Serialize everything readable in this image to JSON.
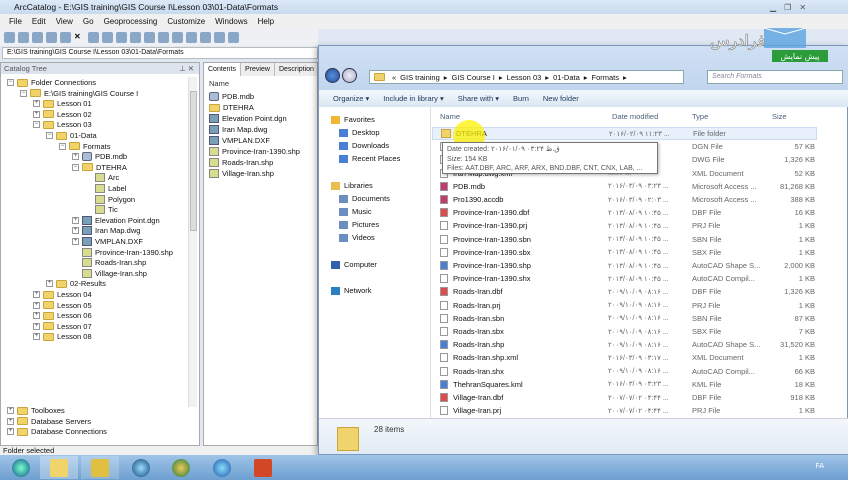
{
  "arccatalog": {
    "title": "ArcCatalog - E:\\GIS training\\GIS Course I\\Lesson 03\\01-Data\\Formats",
    "menu": [
      "File",
      "Edit",
      "View",
      "Go",
      "Geoprocessing",
      "Customize",
      "Windows",
      "Help"
    ],
    "location": "E:\\GIS training\\GIS Course I\\Lesson 03\\01-Data\\Formats",
    "tree_title": "Catalog Tree",
    "tree": [
      {
        "label": "Folder Connections",
        "depth": 0,
        "pm": "−",
        "icon": "fold"
      },
      {
        "label": "E:\\GIS training\\GIS Course I",
        "depth": 1,
        "pm": "−",
        "icon": "fold"
      },
      {
        "label": "Lesson 01",
        "depth": 2,
        "pm": "+",
        "icon": "fold"
      },
      {
        "label": "Lesson 02",
        "depth": 2,
        "pm": "+",
        "icon": "fold"
      },
      {
        "label": "Lesson 03",
        "depth": 2,
        "pm": "−",
        "icon": "fold"
      },
      {
        "label": "01-Data",
        "depth": 3,
        "pm": "−",
        "icon": "fold"
      },
      {
        "label": "Formats",
        "depth": 4,
        "pm": "−",
        "icon": "fold"
      },
      {
        "label": "PDB.mdb",
        "depth": 5,
        "pm": "+",
        "icon": "db"
      },
      {
        "label": "DTEHRA",
        "depth": 5,
        "pm": "−",
        "icon": "fold"
      },
      {
        "label": "Arc",
        "depth": 6,
        "pm": "",
        "icon": "lyr"
      },
      {
        "label": "Label",
        "depth": 6,
        "pm": "",
        "icon": "lyr"
      },
      {
        "label": "Polygon",
        "depth": 6,
        "pm": "",
        "icon": "lyr"
      },
      {
        "label": "Tic",
        "depth": 6,
        "pm": "",
        "icon": "lyr"
      },
      {
        "label": "Elevation Point.dgn",
        "depth": 5,
        "pm": "+",
        "icon": "cad"
      },
      {
        "label": "Iran Map.dwg",
        "depth": 5,
        "pm": "+",
        "icon": "cad"
      },
      {
        "label": "VMPLAN.DXF",
        "depth": 5,
        "pm": "+",
        "icon": "cad"
      },
      {
        "label": "Province-Iran-1390.shp",
        "depth": 5,
        "pm": "",
        "icon": "lyr"
      },
      {
        "label": "Roads-Iran.shp",
        "depth": 5,
        "pm": "",
        "icon": "lyr"
      },
      {
        "label": "Village-Iran.shp",
        "depth": 5,
        "pm": "",
        "icon": "lyr"
      },
      {
        "label": "02-Results",
        "depth": 3,
        "pm": "+",
        "icon": "fold"
      },
      {
        "label": "Lesson 04",
        "depth": 2,
        "pm": "+",
        "icon": "fold"
      },
      {
        "label": "Lesson 05",
        "depth": 2,
        "pm": "+",
        "icon": "fold"
      },
      {
        "label": "Lesson 06",
        "depth": 2,
        "pm": "+",
        "icon": "fold"
      },
      {
        "label": "Lesson 07",
        "depth": 2,
        "pm": "+",
        "icon": "fold"
      },
      {
        "label": "Lesson 08",
        "depth": 2,
        "pm": "+",
        "icon": "fold"
      }
    ],
    "tree_bottom": [
      "Toolboxes",
      "Database Servers",
      "Database Connections"
    ],
    "tabs": [
      "Contents",
      "Preview",
      "Description"
    ],
    "contents_header": "Name",
    "contents": [
      "PDB.mdb",
      "DTEHRA",
      "Elevation Point.dgn",
      "Iran Map.dwg",
      "VMPLAN.DXF",
      "Province-Iran-1390.shp",
      "Roads-Iran.shp",
      "Village-Iran.shp"
    ],
    "status": "Folder selected"
  },
  "explorer": {
    "breadcrumb": [
      "«",
      "GIS training",
      "GIS Course I",
      "Lesson 03",
      "01-Data",
      "Formats"
    ],
    "search_placeholder": "Search Formats",
    "commands": [
      "Organize ▾",
      "Include in library ▾",
      "Share with ▾",
      "Burn",
      "New folder"
    ],
    "nav": {
      "favorites": "Favorites",
      "fav_items": [
        "Desktop",
        "Downloads",
        "Recent Places"
      ],
      "libraries": "Libraries",
      "lib_items": [
        "Documents",
        "Music",
        "Pictures",
        "Videos"
      ],
      "computer": "Computer",
      "network": "Network"
    },
    "columns": [
      "Name",
      "Date modified",
      "Type",
      "Size"
    ],
    "files": [
      {
        "name": "DTEHRA",
        "date": "۲۰۱۶/۰۲/۰۹ ۱۱:۲۳ ...",
        "type": "File folder",
        "size": "",
        "icon": "fold2"
      },
      {
        "name": "Elevation Point.dgn",
        "date": "...:۱۳ ...",
        "type": "DGN File",
        "size": "57 KB",
        "icon": ""
      },
      {
        "name": "Iran Map.dwg",
        "date": "...:۰۳ ...",
        "type": "DWG File",
        "size": "1,326 KB",
        "icon": ""
      },
      {
        "name": "Iran Map.dwg.xml",
        "date": "...:۲۳ ...",
        "type": "XML Document",
        "size": "52 KB",
        "icon": ""
      },
      {
        "name": "PDB.mdb",
        "date": "۲۰۱۶/۰۳/۰۹ ۰۳:۲۳ ...",
        "type": "Microsoft Access ...",
        "size": "81,268 KB",
        "icon": "acc"
      },
      {
        "name": "Pro1390.accdb",
        "date": "۲۰۱۶/۰۳/۰۹ ۰۲:۰۳ ...",
        "type": "Microsoft Access ...",
        "size": "388 KB",
        "icon": "acc"
      },
      {
        "name": "Province-Iran-1390.dbf",
        "date": "۲۰۱۳/۰۸/۰۹ ۱۰:۴۵ ...",
        "type": "DBF File",
        "size": "16 KB",
        "icon": "red"
      },
      {
        "name": "Province-Iran-1390.prj",
        "date": "۲۰۱۳/۰۸/۰۹ ۱۰:۴۵ ...",
        "type": "PRJ File",
        "size": "1 KB",
        "icon": ""
      },
      {
        "name": "Province-Iran-1390.sbn",
        "date": "۲۰۱۳/۰۸/۰۹ ۱۰:۴۵ ...",
        "type": "SBN File",
        "size": "1 KB",
        "icon": ""
      },
      {
        "name": "Province-Iran-1390.sbx",
        "date": "۲۰۱۳/۰۸/۰۹ ۱۰:۴۵ ...",
        "type": "SBX File",
        "size": "1 KB",
        "icon": ""
      },
      {
        "name": "Province-Iran-1390.shp",
        "date": "۲۰۱۳/۰۸/۰۹ ۱۰:۴۵ ...",
        "type": "AutoCAD Shape S...",
        "size": "2,000 KB",
        "icon": "blue"
      },
      {
        "name": "Province-Iran-1390.shx",
        "date": "۲۰۱۳/۰۸/۰۹ ۱۰:۴۵ ...",
        "type": "AutoCAD Compil...",
        "size": "1 KB",
        "icon": ""
      },
      {
        "name": "Roads-Iran.dbf",
        "date": "۲۰۰۹/۱۰/۰۹ ۰۸:۱۶ ...",
        "type": "DBF File",
        "size": "1,326 KB",
        "icon": "red"
      },
      {
        "name": "Roads-Iran.prj",
        "date": "۲۰۰۹/۱۰/۰۹ ۰۸:۱۶ ...",
        "type": "PRJ File",
        "size": "1 KB",
        "icon": ""
      },
      {
        "name": "Roads-Iran.sbn",
        "date": "۲۰۰۹/۱۰/۰۹ ۰۸:۱۶ ...",
        "type": "SBN File",
        "size": "87 KB",
        "icon": ""
      },
      {
        "name": "Roads-Iran.sbx",
        "date": "۲۰۰۹/۱۰/۰۹ ۰۸:۱۶ ...",
        "type": "SBX File",
        "size": "7 KB",
        "icon": ""
      },
      {
        "name": "Roads-Iran.shp",
        "date": "۲۰۰۹/۱۰/۰۹ ۰۸:۱۶ ...",
        "type": "AutoCAD Shape S...",
        "size": "31,520 KB",
        "icon": "blue"
      },
      {
        "name": "Roads-Iran.shp.xml",
        "date": "۲۰۱۶/۰۳/۰۹ ۰۳:۱۷ ...",
        "type": "XML Document",
        "size": "1 KB",
        "icon": ""
      },
      {
        "name": "Roads-Iran.shx",
        "date": "۲۰۰۹/۱۰/۰۹ ۰۸:۱۶ ...",
        "type": "AutoCAD Compil...",
        "size": "66 KB",
        "icon": ""
      },
      {
        "name": "ThehranSquares.kml",
        "date": "۲۰۱۶/۰۳/۰۹ ۰۳:۲۳ ...",
        "type": "KML File",
        "size": "18 KB",
        "icon": "blue"
      },
      {
        "name": "Village-Iran.dbf",
        "date": "۲۰۰۷/۰۷/۰۲ ۰۴:۴۴ ...",
        "type": "DBF File",
        "size": "918 KB",
        "icon": "red"
      },
      {
        "name": "Village-Iran.prj",
        "date": "۲۰۰۷/۰۷/۰۲ ۰۴:۴۴ ...",
        "type": "PRJ File",
        "size": "1 KB",
        "icon": ""
      }
    ],
    "tooltip": [
      "Date created: ۲۰۱۶/۰۱/۰۹ ق.ظ ۰۳:۲۴",
      "Size: 154 KB",
      "Files: AAT.DBF, ARC, ARF, ARX, BND.DBF, CNT, CNX, LAB, ..."
    ],
    "item_count": "28 items"
  },
  "watermark": {
    "logo_text": "فرادرس",
    "preview_badge": "پیش نمایش"
  },
  "taskbar": {
    "lang": "FA"
  }
}
